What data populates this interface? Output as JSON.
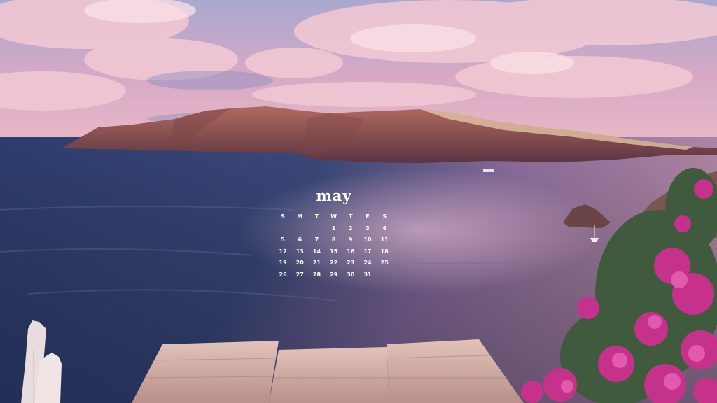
{
  "calendar": {
    "month": "may",
    "weekdays": [
      "S",
      "M",
      "T",
      "W",
      "T",
      "F",
      "S"
    ],
    "weeks": [
      [
        "",
        "",
        "",
        "1",
        "2",
        "3",
        "4"
      ],
      [
        "5",
        "6",
        "7",
        "8",
        "9",
        "10",
        "11"
      ],
      [
        "12",
        "13",
        "14",
        "15",
        "16",
        "17",
        "18"
      ],
      [
        "19",
        "20",
        "21",
        "22",
        "23",
        "24",
        "25"
      ],
      [
        "26",
        "27",
        "28",
        "29",
        "30",
        "31",
        ""
      ]
    ]
  }
}
